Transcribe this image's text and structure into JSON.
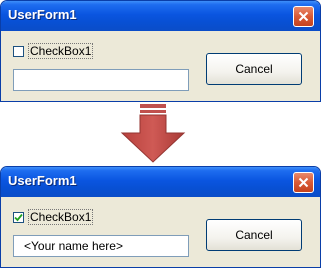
{
  "colors": {
    "titlebar_blue": "#0a55e0",
    "close_red": "#d95a36",
    "dialog_bg": "#ece9d8",
    "arrow_red": "#c0504d"
  },
  "arrow": {
    "icon": "down-arrow-icon",
    "direction": "down"
  },
  "before": {
    "title": "UserForm1",
    "checkbox": {
      "label": "CheckBox1",
      "checked": false
    },
    "textbox": {
      "value": ""
    },
    "cancel_label": "Cancel"
  },
  "after": {
    "title": "UserForm1",
    "checkbox": {
      "label": "CheckBox1",
      "checked": true
    },
    "textbox": {
      "value": "<Your name here>"
    },
    "cancel_label": "Cancel"
  }
}
